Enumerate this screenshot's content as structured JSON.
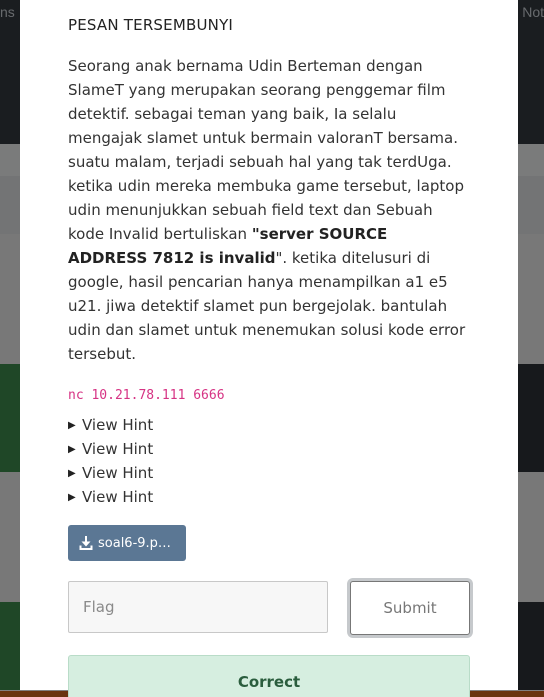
{
  "background": {
    "nav_left_text": "ns",
    "nav_right_text": "Not"
  },
  "modal": {
    "title": "PESAN TERSEMBUNYI",
    "description_parts": {
      "p1": "Seorang anak bernama Udin Berteman dengan SlameT yang merupakan seorang penggemar film detektif. sebagai teman yang baik, Ia selalu mengajak slamet untuk bermain valoranT bersama. suatu malam, terjadi sebuah hal yang tak terdUga. ketika udin mereka membuka game tersebut, laptop udin menunjukkan sebuah field text dan Sebuah kode Invalid bertuliskan ",
      "bold": "\"server SOURCE ADDRESS 7812 is invalid",
      "p2": "\". ketika ditelusuri di google, hasil pencarian hanya menampilkan a1 e5 u21. jiwa detektif slamet pun bergejolak. bantulah udin dan slamet untuk menemukan solusi kode error tersebut."
    },
    "connection": "nc 10.21.78.111 6666",
    "hints": [
      "View Hint",
      "View Hint",
      "View Hint",
      "View Hint"
    ],
    "file_button": "soal6-9.pc...",
    "flag_placeholder": "Flag",
    "submit_label": "Submit",
    "status_text": "Correct"
  },
  "colors": {
    "accent_file_button": "#5b7794",
    "connection_text": "#d63384",
    "success_bg": "#d6eee0",
    "success_text": "#2a5d3d"
  },
  "icons": {
    "file_button": "download-icon"
  }
}
